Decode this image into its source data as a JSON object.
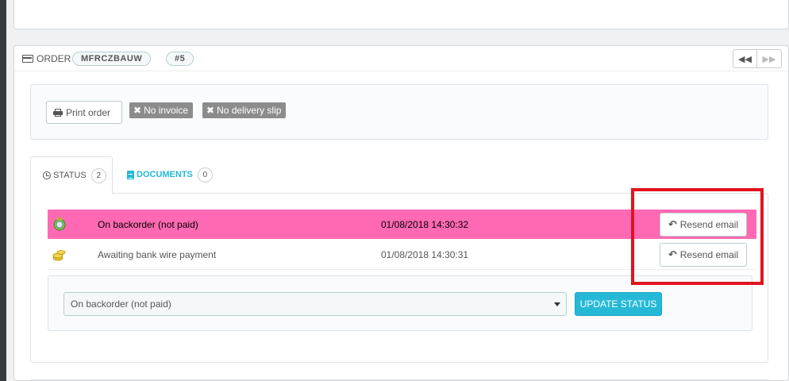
{
  "order_panel": {
    "title": "Order",
    "reference": "MFRCZBAUW",
    "order_number": "#5",
    "icon": "credit-card-icon",
    "nav": {
      "prev_icon": "backward-icon",
      "next_icon": "forward-icon"
    }
  },
  "actions": {
    "print_label": "Print order",
    "no_invoice_label": "No invoice",
    "no_delivery_slip_label": "No delivery slip"
  },
  "tabs": [
    {
      "label": "Status",
      "count": "2",
      "icon": "clock-icon"
    },
    {
      "label": "Documents",
      "count": "0",
      "icon": "file-icon"
    }
  ],
  "history": [
    {
      "status": "On backorder (not paid)",
      "date": "01/08/2018 14:30:32",
      "button": "Resend email",
      "highlight_color": "#ff69b4",
      "icon": "backorder-icon"
    },
    {
      "status": "Awaiting bank wire payment",
      "date": "01/08/2018 14:30:31",
      "button": "Resend email",
      "icon": "coins-icon"
    }
  ],
  "update_form": {
    "selected_status": "On backorder (not paid)",
    "submit_label": "Update status"
  },
  "colors": {
    "accent": "#25b9d7",
    "highlight_row": "#ff69b4",
    "annotation_box": "#e0141e"
  }
}
